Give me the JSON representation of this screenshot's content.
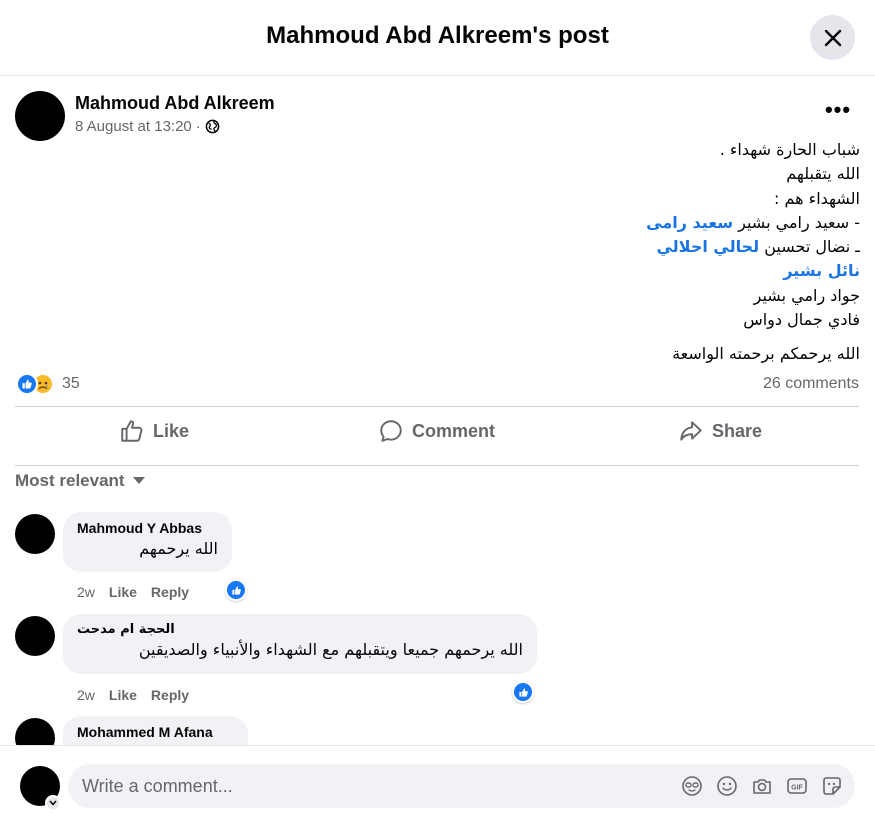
{
  "header": {
    "title": "Mahmoud Abd Alkreem's post"
  },
  "post": {
    "author": "Mahmoud Abd Alkreem",
    "timestamp": "8 August at 13:20",
    "separator": "·",
    "audience_icon": "globe-icon",
    "lines": {
      "l1": "شباب الحارة شهداء .",
      "l2": "الله يتقبلهم",
      "l3": "الشهداء هم :",
      "l4_prefix": "- سعيد رامي بشير ",
      "l4_tag": "سعيد رامى",
      "l5_prefix": "ـ نضال تحسين ",
      "l5_tag": "لحالي احلالي",
      "l6_tag": "نائل بشير",
      "l7": "جواد رامي بشير",
      "l8": "فادي جمال دواس",
      "l9": "الله يرحمكم برحمته الواسعة"
    },
    "reaction_count": "35",
    "comments_count": "26 comments"
  },
  "actions": {
    "like": "Like",
    "comment": "Comment",
    "share": "Share"
  },
  "sort": {
    "label": "Most relevant"
  },
  "comments": [
    {
      "name": "Mahmoud Y Abbas",
      "text": "الله يرحمهم",
      "time": "2w",
      "like": "Like",
      "reply": "Reply"
    },
    {
      "name": "الحجة ام مدحت",
      "text": "الله يرحمهم جميعا ويتقبلهم مع الشهداء والأنبياء والصديقين",
      "time": "2w",
      "like": "Like",
      "reply": "Reply"
    },
    {
      "name": "Mohammed M Afana"
    }
  ],
  "composer": {
    "placeholder": "Write a comment..."
  },
  "colors": {
    "accent": "#1877f2",
    "link": "#1b74e4",
    "muted": "#65676b",
    "bubble": "#f0f2f5"
  }
}
